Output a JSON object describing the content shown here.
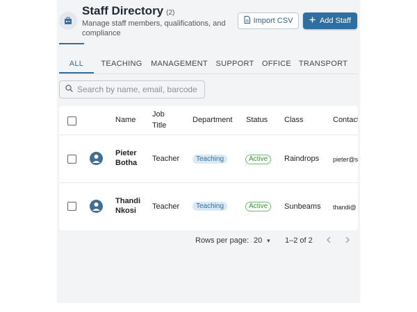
{
  "header": {
    "title": "Staff Directory",
    "count": "(2)",
    "subtitle": "Manage staff members, qualifications, and compliance",
    "icon": "staff-badge-icon"
  },
  "actions": {
    "import_label": "Import CSV",
    "add_label": "Add Staff"
  },
  "tabs": [
    "ALL",
    "TEACHING",
    "MANAGEMENT",
    "SUPPORT",
    "OFFICE",
    "TRANSPORT"
  ],
  "active_tab": "ALL",
  "search": {
    "placeholder": "Search by name, email, barcode"
  },
  "table": {
    "columns": [
      "Name",
      "Job Title",
      "Department",
      "Status",
      "Class",
      "Contact"
    ],
    "rows": [
      {
        "name": "Pieter Botha",
        "job_title": "Teacher",
        "department": "Teaching",
        "status": "Active",
        "class": "Raindrops",
        "contact": "pieter@s"
      },
      {
        "name": "Thandi Nkosi",
        "job_title": "Teacher",
        "department": "Teaching",
        "status": "Active",
        "class": "Sunbeams",
        "contact": "thandi@"
      }
    ]
  },
  "pagination": {
    "rows_per_page_label": "Rows per page:",
    "rows_per_page": "20",
    "range": "1–2 of 2"
  },
  "colors": {
    "accent": "#2f6ea1",
    "status_active": "#3d8f3d",
    "panel_bg": "#f3f4f6"
  }
}
